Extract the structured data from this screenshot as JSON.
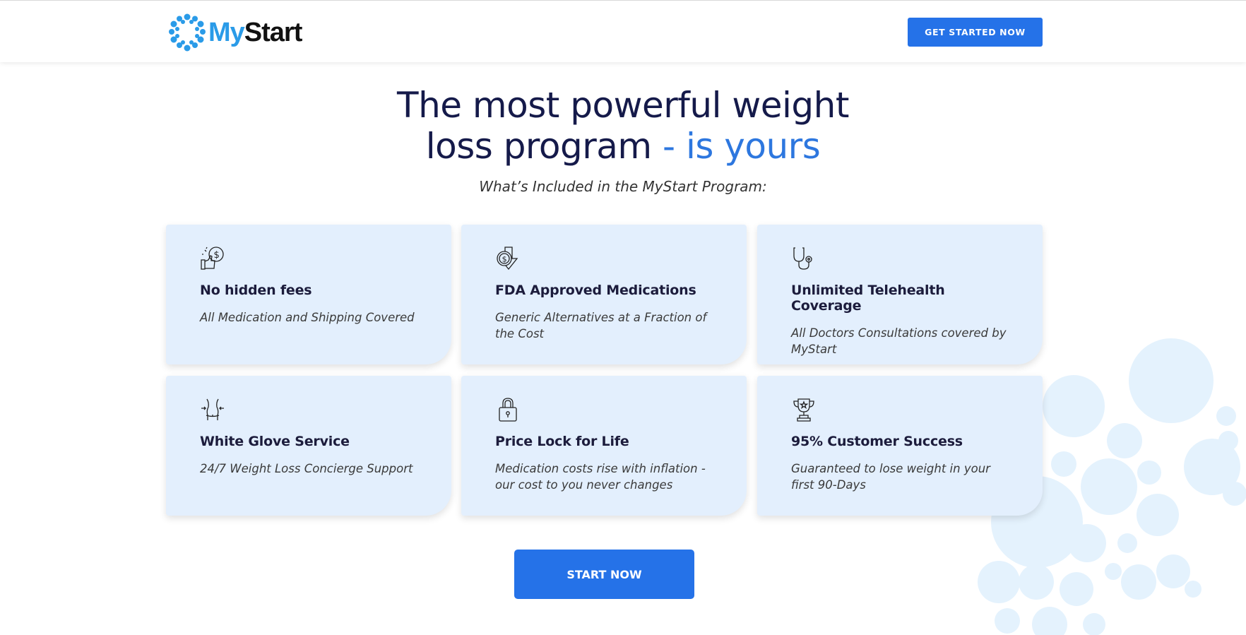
{
  "brand": {
    "logo_prefix": "My",
    "logo_suffix": "Start",
    "logo_icon": "bubble-ring-logo-icon",
    "colors": {
      "primary": "#2572e8",
      "accent_text": "#2d77df",
      "logo_blue": "#2a9be8",
      "card_bg": "#e3effd",
      "heading": "#151a4a"
    }
  },
  "header": {
    "cta_label": "GET STARTED NOW"
  },
  "hero": {
    "title_line1": "The most powerful weight",
    "title_line2_main": "loss program",
    "title_line2_accent": " - is yours",
    "subtitle": "What’s Included in the MyStart Program:"
  },
  "features": [
    {
      "icon": "thumbs-up-dollar-icon",
      "title": "No hidden fees",
      "description": "All Medication and Shipping Covered"
    },
    {
      "icon": "dollar-down-arrow-icon",
      "title": "FDA Approved Medications",
      "description": "Generic Alternatives at a Fraction of the Cost"
    },
    {
      "icon": "stethoscope-icon",
      "title": "Unlimited Telehealth Coverage",
      "description": "All Doctors Consultations covered by MyStart"
    },
    {
      "icon": "waist-measure-icon",
      "title": "White Glove Service",
      "description": "24/7 Weight Loss Concierge Support"
    },
    {
      "icon": "padlock-icon",
      "title": "Price Lock for Life",
      "description": "Medication costs rise with inflation - our cost to you never changes"
    },
    {
      "icon": "trophy-icon",
      "title": "95% Customer Success",
      "description": "Guaranteed to lose weight in your first 90-Days"
    }
  ],
  "cta": {
    "start_label": "START NOW"
  }
}
